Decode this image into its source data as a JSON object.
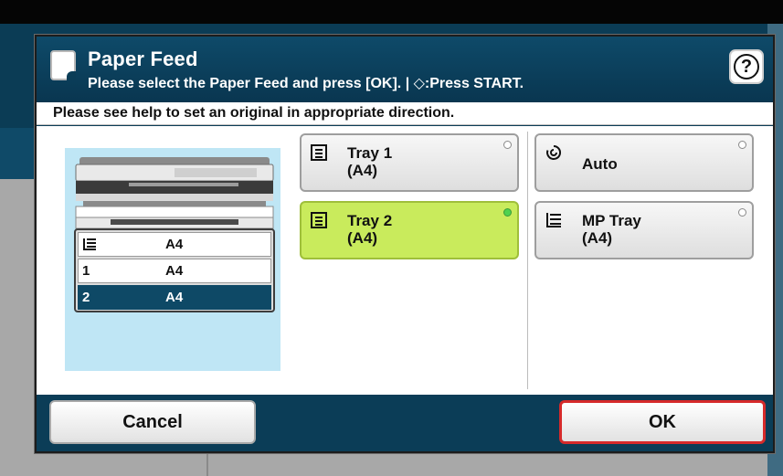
{
  "dialog": {
    "title": "Paper Feed",
    "subtitle": "Please select the Paper Feed and press [OK]. | ◇:Press START.",
    "help_icon": "?",
    "info": "Please see help to set an original in appropriate direction."
  },
  "preview": {
    "rows": [
      {
        "key_icon": "mp-tray-icon",
        "key": "",
        "value": "A4",
        "selected": false
      },
      {
        "key": "1",
        "value": "A4",
        "selected": false
      },
      {
        "key": "2",
        "value": "A4",
        "selected": true
      }
    ]
  },
  "options": [
    {
      "line1": "Tray 1",
      "line2": "(A4)",
      "icon": "tray-icon",
      "selected": false
    },
    {
      "line1": "Auto",
      "line2": "",
      "icon": "auto-select-icon",
      "selected": false
    },
    {
      "line1": "Tray 2",
      "line2": "(A4)",
      "icon": "tray-icon",
      "selected": true
    },
    {
      "line1": "MP Tray",
      "line2": "(A4)",
      "icon": "mp-tray-icon",
      "selected": false
    }
  ],
  "footer": {
    "cancel_label": "Cancel",
    "ok_label": "OK"
  },
  "colors": {
    "frame": "#0b3d57",
    "selected_option": "#c9eb5c",
    "selected_row": "#0e4966",
    "ok_border": "#d62a2a",
    "preview_bg": "#bfe6f5"
  }
}
